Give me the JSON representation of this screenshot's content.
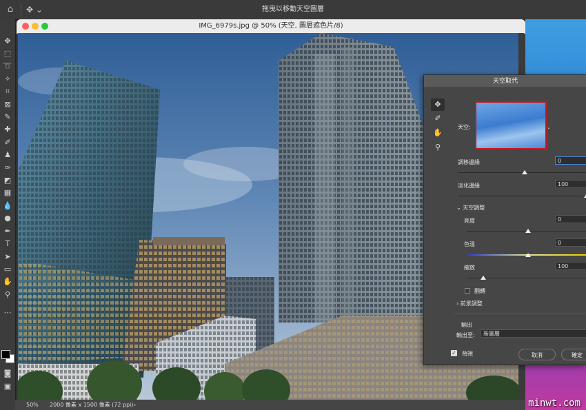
{
  "app": {
    "top_hint": "拖曳以移動天空圖層",
    "move_tool_arrow": "⌄"
  },
  "document": {
    "title": "IMG_6979s.jpg @ 50% (天空, 圖層遮色片/8)",
    "zoom": "50%",
    "dimensions": "2000 像素 x 1500 像素 (72 ppi)",
    "status_chevron": "›"
  },
  "toolbar": {
    "tools": [
      "move-tool",
      "marquee-tool",
      "lasso-tool",
      "magic-wand-tool",
      "crop-tool",
      "frame-tool",
      "eyedropper-tool",
      "healing-tool",
      "brush-tool",
      "stamp-tool",
      "history-brush-tool",
      "eraser-tool",
      "gradient-tool",
      "blur-tool",
      "dodge-tool",
      "pen-tool",
      "type-tool",
      "path-select-tool",
      "rectangle-tool",
      "hand-tool",
      "zoom-tool",
      "more-tools"
    ]
  },
  "sky_panel": {
    "title": "天空取代",
    "sky_label": "天空:",
    "shift_edge_label": "調移邊緣",
    "shift_edge_value": "0",
    "fade_edge_label": "淡化邊緣",
    "fade_edge_value": "100",
    "sky_adjust_label": "天空調整",
    "brightness_label": "亮度",
    "brightness_value": "0",
    "temperature_label": "色溫",
    "temperature_value": "0",
    "scale_label": "縮放",
    "scale_value": "100",
    "flip_label": "翻轉",
    "foreground_label": "前景調整",
    "output_label": "輸出",
    "output_to_label": "輸出至:",
    "output_to_value": "新圖層",
    "preview_label": "預視",
    "cancel_label": "取消",
    "ok_label": "確定",
    "slider_levels": {
      "shift_edge": 0.5,
      "fade_edge": 1.0,
      "brightness": 0.5,
      "temperature": 0.5,
      "scale": 0.3
    }
  },
  "watermark": "minwt.com",
  "colors": {
    "highlight": "#d0121b",
    "panel_bg": "#464646"
  }
}
